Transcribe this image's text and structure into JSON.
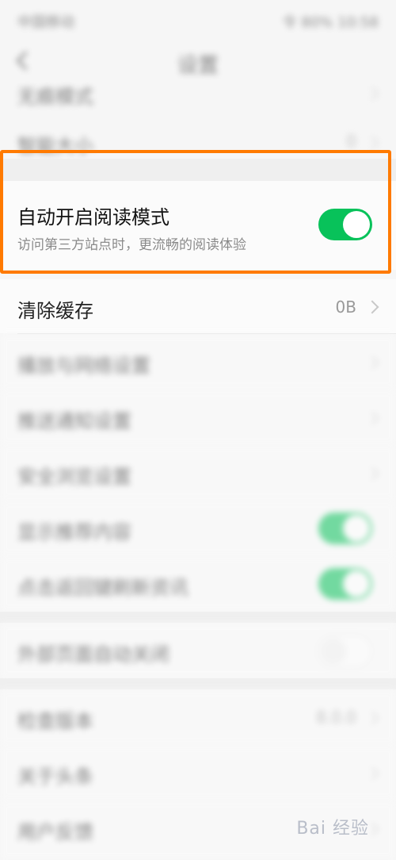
{
  "status_bar": {
    "left": "中国移动",
    "right": "令 80% 10:58"
  },
  "header": {
    "title": "设置"
  },
  "rows_above": [
    {
      "label": "无痕模式"
    },
    {
      "label": "智能大小",
      "value": "0"
    }
  ],
  "read_mode": {
    "title": "自动开启阅读模式",
    "subtitle": "访问第三方站点时，更流畅的阅读体验",
    "toggle_on": true
  },
  "clear_cache": {
    "label": "清除缓存",
    "value": "0B"
  },
  "blurred_rows": [
    {
      "label": "播放与网络设置"
    },
    {
      "label": "推送通知设置"
    },
    {
      "label": "安全浏览设置"
    },
    {
      "label": "显示推荐内容"
    },
    {
      "label": "点击返回键刷新资讯"
    },
    {
      "label": "外部页面自动关闭"
    },
    {
      "label": "检查版本",
      "value": "8.0.0"
    },
    {
      "label": "关于头条"
    },
    {
      "label": "用户反馈"
    }
  ],
  "watermark": "Bai 经验"
}
